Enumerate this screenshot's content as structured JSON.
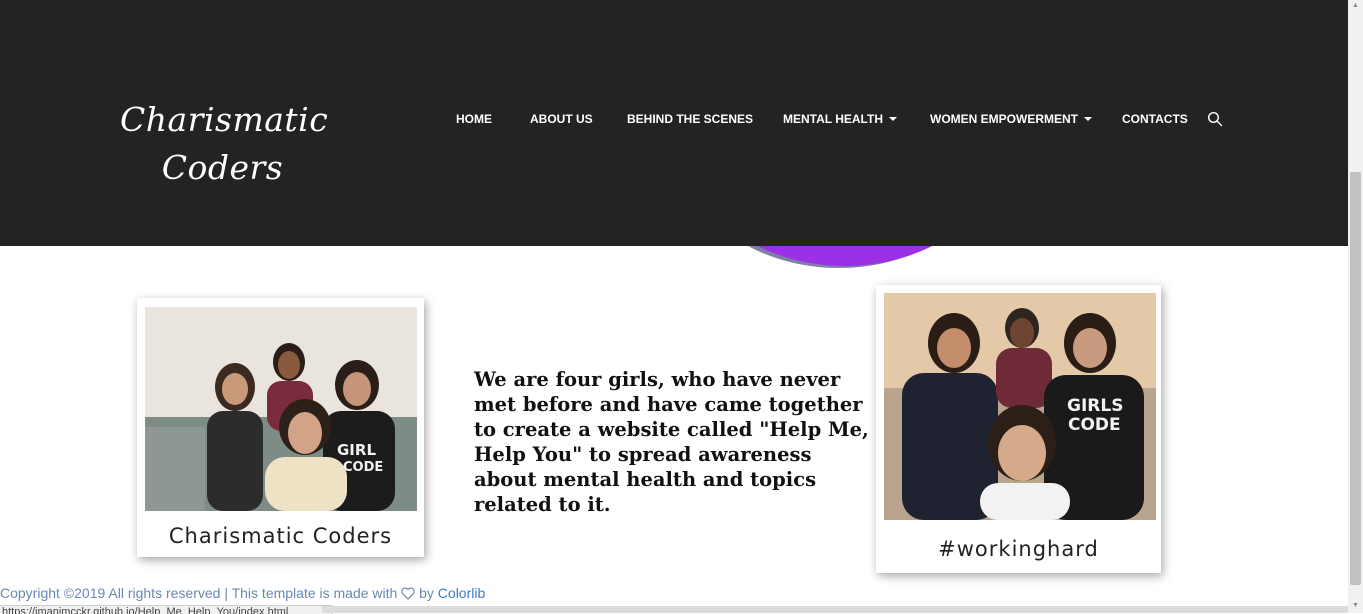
{
  "brand": {
    "line1": "Charismatic",
    "line2": "Coders"
  },
  "nav": {
    "items": [
      {
        "label": "HOME",
        "dropdown": false
      },
      {
        "label": "ABOUT US",
        "dropdown": false
      },
      {
        "label": "BEHIND THE SCENES",
        "dropdown": false
      },
      {
        "label": "MENTAL HEALTH",
        "dropdown": true
      },
      {
        "label": "WOMEN EMPOWERMENT",
        "dropdown": true
      },
      {
        "label": "CONTACTS",
        "dropdown": false
      }
    ],
    "search_icon": "search-icon"
  },
  "gallery": {
    "left_caption": "Charismatic Coders",
    "right_caption": "#workinghard"
  },
  "about": {
    "text": "We are four girls, who have never met before and have came together to create a website called \"Help Me, Help You\" to spread awareness about mental health and topics related to it."
  },
  "footer": {
    "prefix": "Copyright ©2019 All rights reserved | This template is made with",
    "by": "by",
    "link": "Colorlib"
  },
  "status_url": "https://imanimcckr.github.io/Help_Me_Help_You/index.html",
  "colors": {
    "header_bg": "#232323",
    "accent_purple": "#9b30e8",
    "footer_link": "#3b79c7"
  }
}
